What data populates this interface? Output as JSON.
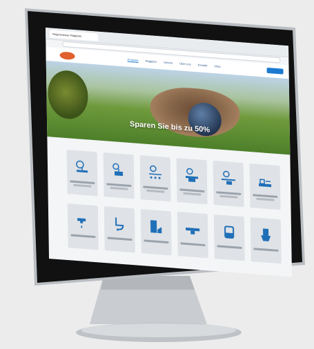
{
  "browser": {
    "tab_title": "Regenwasser-Ratgeber",
    "url": ""
  },
  "nav": {
    "items": [
      "Produkte",
      "Ratgeber",
      "Service",
      "Über uns",
      "Kontakt",
      "Shop"
    ],
    "active_index": 0
  },
  "hero": {
    "headline": "Sparen Sie bis zu 50%"
  },
  "tiles": [
    {
      "icon": "rain-house-icon"
    },
    {
      "icon": "rain-house-tank-icon"
    },
    {
      "icon": "rain-droplets-icon"
    },
    {
      "icon": "pipe-basin-icon"
    },
    {
      "icon": "tank-pipe-icon"
    },
    {
      "icon": "garden-system-icon"
    },
    {
      "icon": "faucet-icon"
    },
    {
      "icon": "toilet-icon"
    },
    {
      "icon": "washing-icon"
    },
    {
      "icon": "drain-channel-icon"
    },
    {
      "icon": "cistern-icon"
    },
    {
      "icon": "pump-icon"
    }
  ],
  "colors": {
    "accent": "#1c7ad1",
    "icon_blue": "#1f6fb8",
    "logo": "#e0612b"
  }
}
